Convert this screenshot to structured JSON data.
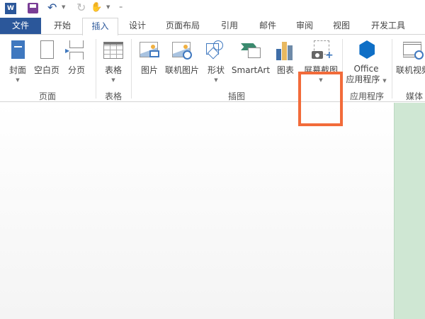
{
  "quick_access": {
    "icons": [
      "word-logo-icon",
      "save-icon",
      "undo-icon",
      "redo-icon",
      "touch-mode-icon",
      "customize-icon"
    ]
  },
  "tabs": [
    {
      "label": "文件"
    },
    {
      "label": "开始"
    },
    {
      "label": "插入",
      "active": true
    },
    {
      "label": "设计"
    },
    {
      "label": "页面布局"
    },
    {
      "label": "引用"
    },
    {
      "label": "邮件"
    },
    {
      "label": "审阅"
    },
    {
      "label": "视图"
    },
    {
      "label": "开发工具"
    }
  ],
  "ribbon": {
    "buttons": [
      {
        "label": "封面"
      },
      {
        "label": "空白页"
      },
      {
        "label": "分页"
      },
      {
        "label": "表格"
      },
      {
        "label": "图片"
      },
      {
        "label": "联机图片"
      },
      {
        "label": "形状"
      },
      {
        "label": "SmartArt"
      },
      {
        "label": "图表"
      },
      {
        "label": "屏幕截图"
      },
      {
        "label": "Office",
        "label2": "应用程序"
      },
      {
        "label": "联机视频"
      }
    ],
    "groups": [
      {
        "label": "页面"
      },
      {
        "label": "表格"
      },
      {
        "label": "插图"
      },
      {
        "label": "应用程序"
      },
      {
        "label": "媒体"
      }
    ]
  },
  "colors": {
    "accent": "#2b579a",
    "highlight": "#f26b3a",
    "page": "#cfe7d3"
  }
}
